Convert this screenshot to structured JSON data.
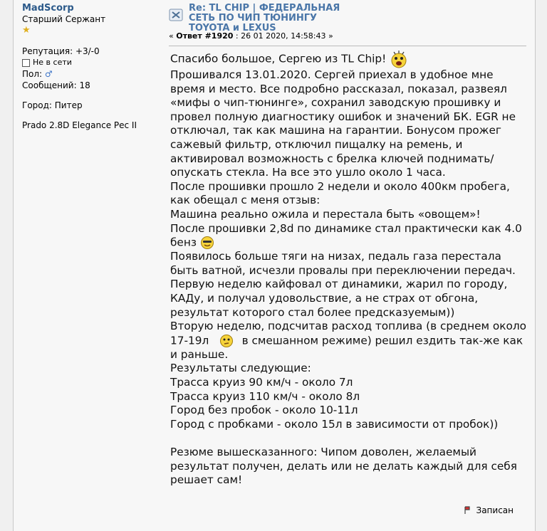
{
  "poster": {
    "name": "MadScorp",
    "rank": "Старший Сержант",
    "reputation": "Репутация: +3/-0",
    "online": "Не в сети",
    "gender_label": "Пол:",
    "posts": "Сообщений: 18",
    "city": "Город: Питер",
    "car": "Prado 2.8D Elegance Рес II"
  },
  "post": {
    "title_lines": [
      "Re: TL CHIP | ФЕДЕРАЛЬНАЯ",
      "СЕТЬ ПО ЧИП ТЮНИНГУ",
      "TOYOTA и LEXUS"
    ],
    "meta_prefix": "« ",
    "answer_label": "Ответ #1920",
    "meta_rest": " : 26 01 2020, 14:58:43 »",
    "lines": [
      "Спасибо большое, Сергею из TL Chip!",
      "Прошивался 13.01.2020. Сергей приехал в удобное мне время и место. Все подробно рассказал, показал, развеял «мифы о чип-тюнинге», сохранил заводскую прошивку и провел полную диагностику ошибок и значений БК. EGR не отключал, так как машина на гарантии. Бонусом прожег сажевый фильтр, отключил пищалку на ремень, и активировал возможность с брелка ключей поднимать/опускать стекла. На все это ушло около 1 часа.",
      "После прошивки прошло 2 недели и около 400км пробега, как обещал с меня отзыв:",
      "Машина реально ожила и перестала быть «овощем»!",
      "После прошивки 2,8d по динамике стал практически как 4.0 бенз",
      "Появилось больше тяги на низах, педаль газа перестала быть ватной, исчезли провалы при переключении передач.",
      "Первую неделю кайфовал от динамики, жарил по городу, КАДу, и получал удовольствие, а не страх от обгона, результат которого стал более предсказуемым))",
      "Вторую неделю, подсчитав расход топлива (в среднем около 17-19л",
      "в смешанном режиме) решил ездить так-же как и раньше.",
      "Результаты следующие:",
      "Трасса круиз 90 км/ч - около 7л",
      "Трасса круиз 110 км/ч - около 8л",
      "Город без пробок - около 10-11л",
      "Город с пробками - около 15л в зависимости от пробок))",
      "Резюме вышесказанного: Чипом доволен, желаемый результат получен, делать или не делать каждый для себя решает сам!"
    ],
    "report_label": "Записан"
  }
}
